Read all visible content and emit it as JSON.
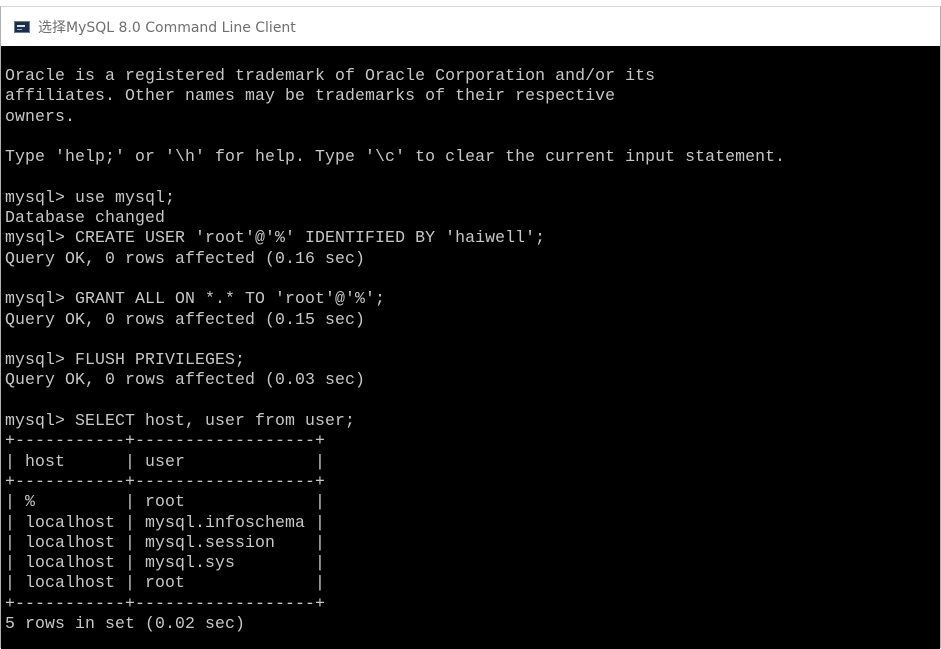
{
  "window": {
    "title": "选择MySQL 8.0 Command Line Client",
    "icon": "console-app-icon"
  },
  "console": {
    "lines": [
      "Oracle is a registered trademark of Oracle Corporation and/or its",
      "affiliates. Other names may be trademarks of their respective",
      "owners.",
      "",
      "Type 'help;' or '\\h' for help. Type '\\c' to clear the current input statement.",
      "",
      "mysql> use mysql;",
      "Database changed",
      "mysql> CREATE USER 'root'@'%' IDENTIFIED BY 'haiwell';",
      "Query OK, 0 rows affected (0.16 sec)",
      "",
      "mysql> GRANT ALL ON *.* TO 'root'@'%';",
      "Query OK, 0 rows affected (0.15 sec)",
      "",
      "mysql> FLUSH PRIVILEGES;",
      "Query OK, 0 rows affected (0.03 sec)",
      "",
      "mysql> SELECT host, user from user;",
      "+-----------+------------------+",
      "| host      | user             |",
      "+-----------+------------------+",
      "| %         | root             |",
      "| localhost | mysql.infoschema |",
      "| localhost | mysql.session    |",
      "| localhost | mysql.sys        |",
      "| localhost | root             |",
      "+-----------+------------------+",
      "5 rows in set (0.02 sec)"
    ]
  }
}
